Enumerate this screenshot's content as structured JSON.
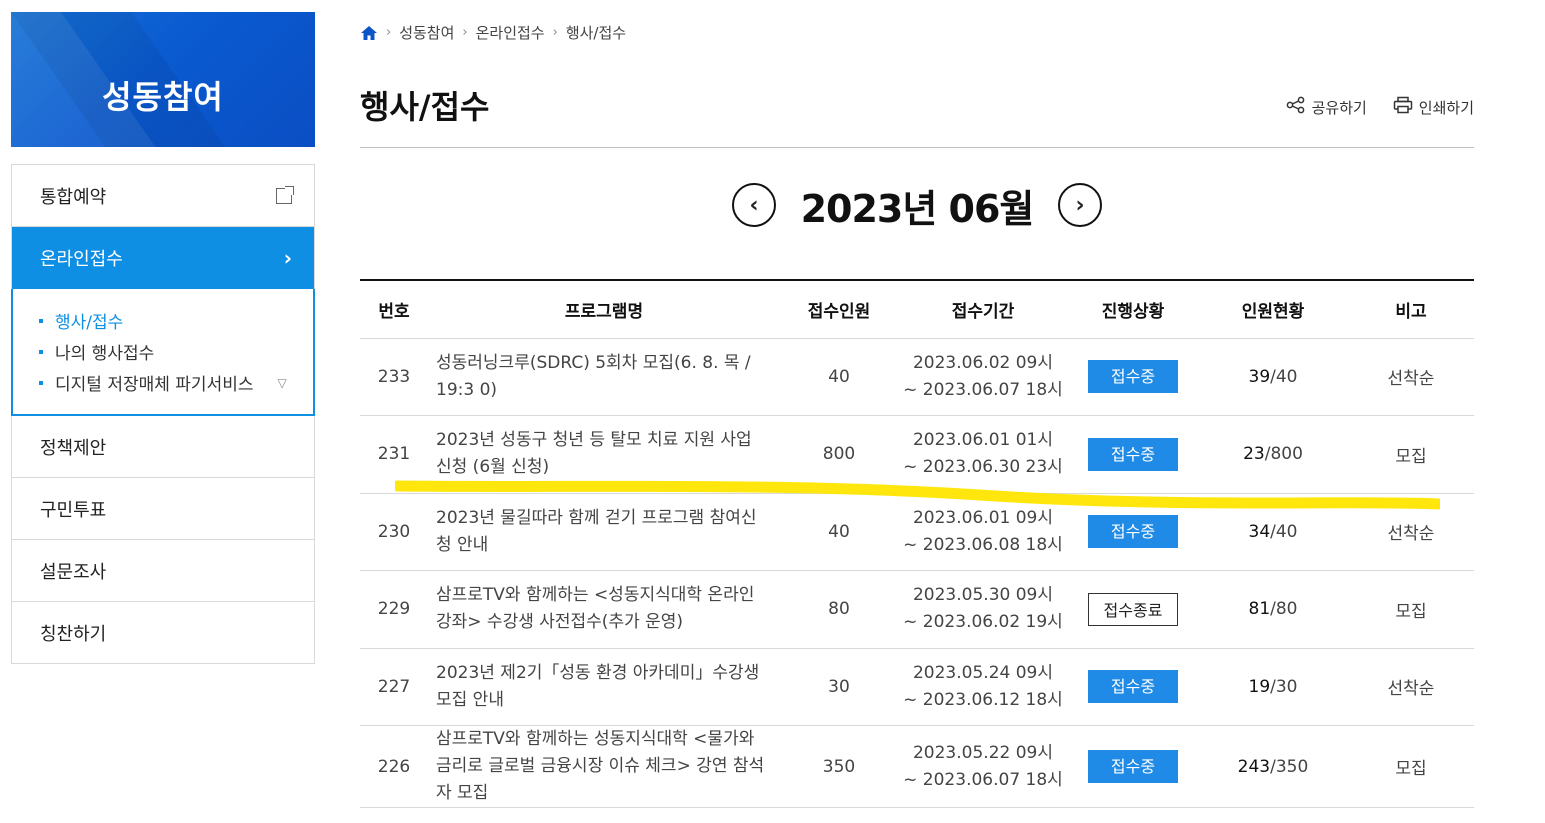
{
  "sidebar": {
    "title": "성동참여",
    "items": [
      {
        "label": "통합예약"
      },
      {
        "label": "온라인접수"
      },
      {
        "label": "정책제안"
      },
      {
        "label": "구민투표"
      },
      {
        "label": "설문조사"
      },
      {
        "label": "칭찬하기"
      }
    ],
    "sub_items": [
      {
        "label": "행사/접수"
      },
      {
        "label": "나의 행사접수"
      },
      {
        "label": "디지털 저장매체 파기서비스"
      }
    ]
  },
  "breadcrumb": [
    "성동참여",
    "온라인접수",
    "행사/접수"
  ],
  "page": {
    "title": "행사/접수",
    "share_label": "공유하기",
    "print_label": "인쇄하기"
  },
  "month_nav": {
    "label": "2023년 06월"
  },
  "table": {
    "headers": [
      "번호",
      "프로그램명",
      "접수인원",
      "접수기간",
      "진행상황",
      "인원현황",
      "비고"
    ],
    "rows": [
      {
        "no": "233",
        "program": "성동러닝크루(SDRC) 5회차 모집(6. 8. 목 / 19:3 0)",
        "capacity": "40",
        "period_start": "2023.06.02 09시",
        "period_end": "~ 2023.06.07 18시",
        "status": "접수중",
        "status_active": true,
        "applied": "39",
        "total": "/40",
        "note": "선착순"
      },
      {
        "no": "231",
        "program": "2023년 성동구 청년 등 탈모 치료 지원 사업 신청 (6월 신청)",
        "capacity": "800",
        "period_start": "2023.06.01 01시",
        "period_end": "~ 2023.06.30 23시",
        "status": "접수중",
        "status_active": true,
        "applied": "23",
        "total": "/800",
        "note": "모집"
      },
      {
        "no": "230",
        "program": "2023년 물길따라 함께 걷기 프로그램 참여신청 안내",
        "capacity": "40",
        "period_start": "2023.06.01 09시",
        "period_end": "~ 2023.06.08 18시",
        "status": "접수중",
        "status_active": true,
        "applied": "34",
        "total": "/40",
        "note": "선착순"
      },
      {
        "no": "229",
        "program": "삼프로TV와 함께하는 <성동지식대학 온라인 강좌> 수강생 사전접수(추가 운영)",
        "capacity": "80",
        "period_start": "2023.05.30 09시",
        "period_end": "~ 2023.06.02 19시",
        "status": "접수종료",
        "status_active": false,
        "applied": "81",
        "total": "/80",
        "note": "모집"
      },
      {
        "no": "227",
        "program": "2023년 제2기「성동 환경 아카데미」수강생 모집 안내",
        "capacity": "30",
        "period_start": "2023.05.24 09시",
        "period_end": "~ 2023.06.12 18시",
        "status": "접수중",
        "status_active": true,
        "applied": "19",
        "total": "/30",
        "note": "선착순"
      },
      {
        "no": "226",
        "program": "삼프로TV와 함께하는 성동지식대학 <물가와 금리로 글로벌 금융시장 이슈 체크> 강연 참석자 모집",
        "capacity": "350",
        "period_start": "2023.05.22 09시",
        "period_end": "~ 2023.06.07 18시",
        "status": "접수중",
        "status_active": true,
        "applied": "243",
        "total": "/350",
        "note": "모집"
      }
    ]
  },
  "colors": {
    "brand_blue": "#0b55c9",
    "active_blue": "#0f8fe3",
    "badge_blue": "#1f8be6",
    "highlight": "#ffe600"
  }
}
